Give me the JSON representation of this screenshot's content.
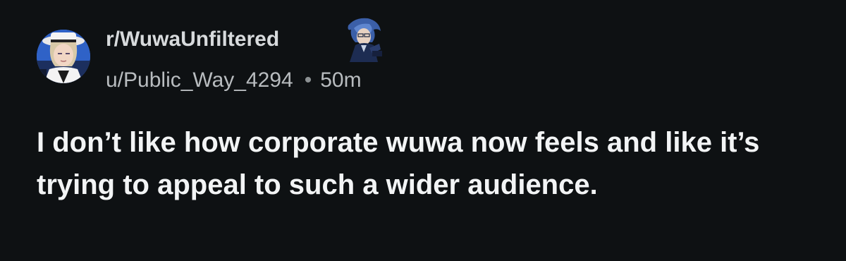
{
  "post": {
    "subreddit": "r/WuwaUnfiltered",
    "author": "u/Public_Way_4294",
    "separator": "•",
    "age": "50m",
    "title": "I don’t like how corporate wuwa now feels and like it’s trying to appeal to such a wider audience."
  },
  "icons": {
    "avatar": "subreddit-avatar-anime-character",
    "flair": "user-flair-anime-character"
  },
  "colors": {
    "background": "#0e1113",
    "title_text": "#f2f4f5",
    "meta_text": "#b8bcbf",
    "subreddit_text": "#d7dadc"
  }
}
